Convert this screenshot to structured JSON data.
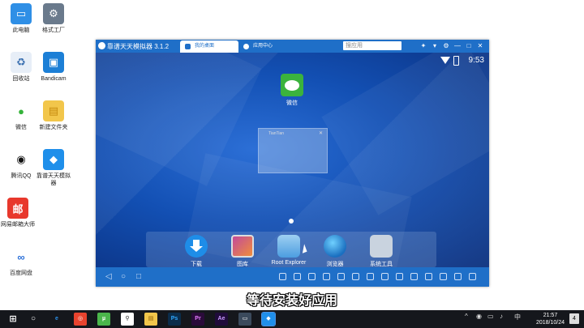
{
  "desktop": {
    "icons": [
      {
        "label": "此电脑",
        "glyph": "▭",
        "bg": "#2f8fe6",
        "fg": "#fff"
      },
      {
        "label": "格式工厂",
        "glyph": "⚙",
        "bg": "#6a7a8c",
        "fg": "#fff"
      },
      {
        "label": "回收站",
        "glyph": "♻",
        "bg": "#e7eef7",
        "fg": "#3a6fb0"
      },
      {
        "label": "Bandicam",
        "glyph": "▣",
        "bg": "#1c7fd6",
        "fg": "#fff"
      },
      {
        "label": "微信",
        "glyph": "●",
        "bg": "#ffffff",
        "fg": "#35b33a"
      },
      {
        "label": "新建文件夹",
        "glyph": "▤",
        "bg": "#f2c64b",
        "fg": "#c58a0e"
      },
      {
        "label": "腾讯QQ",
        "glyph": "◉",
        "bg": "#ffffff",
        "fg": "#111"
      },
      {
        "label": "靠谱天天模拟器",
        "glyph": "◆",
        "bg": "#1f8fea",
        "fg": "#fff"
      },
      {
        "label": "网易邮箱大师",
        "glyph": "邮",
        "bg": "#e8382c",
        "fg": "#fff"
      },
      {
        "label": "百度网盘",
        "glyph": "∞",
        "bg": "#ffffff",
        "fg": "#2a6fd8"
      }
    ]
  },
  "emulator": {
    "title": "靠谱天天模拟器 3.1.2",
    "tabs": [
      "我的桌面",
      "应用中心"
    ],
    "search_placeholder": "搜应用",
    "window_buttons": [
      "✦",
      "▾",
      "⚙",
      "—",
      "□",
      "✕"
    ],
    "status": {
      "time": "9:53"
    },
    "home_apps": [
      {
        "label": "微信"
      }
    ],
    "ghost_window_title": "TianTian",
    "dock_apps": [
      {
        "label": "下载"
      },
      {
        "label": "图库"
      },
      {
        "label": "Root Explorer"
      },
      {
        "label": "浏览器"
      },
      {
        "label": "系统工具"
      }
    ],
    "nav_buttons": [
      "◁",
      "○",
      "□"
    ]
  },
  "subtitle": "等待安装好应用",
  "taskbar": {
    "apps": [
      {
        "glyph": "e",
        "bg": "transparent",
        "fg": "#2b8fe6"
      },
      {
        "glyph": "◎",
        "bg": "#e8432e",
        "fg": "#fff"
      },
      {
        "glyph": "µ",
        "bg": "#4bb64b",
        "fg": "#fff"
      },
      {
        "glyph": "⚲",
        "bg": "#ffffff",
        "fg": "#333"
      },
      {
        "glyph": "▤",
        "bg": "#f2c64b",
        "fg": "#8a5a00"
      },
      {
        "glyph": "Ps",
        "bg": "#0b2c4a",
        "fg": "#31a8ff"
      },
      {
        "glyph": "Pr",
        "bg": "#2a0b3a",
        "fg": "#e77cff"
      },
      {
        "glyph": "Ae",
        "bg": "#1f0b3a",
        "fg": "#c999ff"
      },
      {
        "glyph": "▭",
        "bg": "#3b4a5c",
        "fg": "#fff"
      },
      {
        "glyph": "◆",
        "bg": "#1f8fea",
        "fg": "#fff"
      }
    ],
    "ime": "中",
    "time": "21:57",
    "date": "2018/10/24",
    "notifications": "4"
  }
}
